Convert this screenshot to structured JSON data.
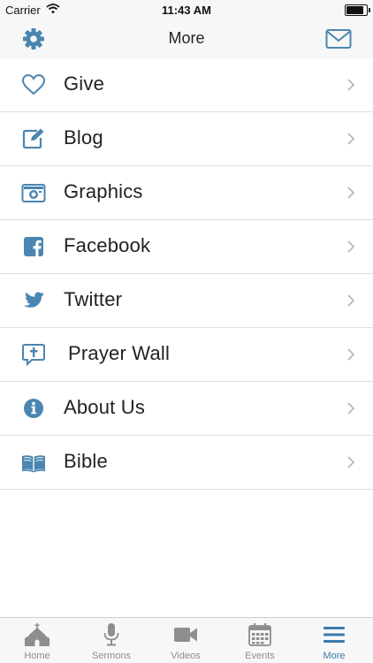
{
  "status": {
    "carrier": "Carrier",
    "time": "11:43 AM",
    "battery_level": 0.95
  },
  "header": {
    "title": "More",
    "left_icon": "gear-icon",
    "right_icon": "mail-icon"
  },
  "menu": {
    "items": [
      {
        "label": "Give",
        "icon": "heart-icon"
      },
      {
        "label": "Blog",
        "icon": "edit-icon"
      },
      {
        "label": "Graphics",
        "icon": "camera-icon"
      },
      {
        "label": "Facebook",
        "icon": "facebook-icon"
      },
      {
        "label": "Twitter",
        "icon": "twitter-icon"
      },
      {
        "label": "Prayer Wall",
        "icon": "prayer-bubble-icon"
      },
      {
        "label": "About Us",
        "icon": "info-icon"
      },
      {
        "label": "Bible",
        "icon": "book-icon"
      }
    ]
  },
  "tabs": [
    {
      "label": "Home",
      "icon": "church-icon"
    },
    {
      "label": "Sermons",
      "icon": "microphone-icon"
    },
    {
      "label": "Videos",
      "icon": "video-camera-icon"
    },
    {
      "label": "Events",
      "icon": "calendar-icon"
    },
    {
      "label": "More",
      "icon": "menu-icon",
      "active": true
    }
  ],
  "colors": {
    "accent": "#3a7bab",
    "icon_blue": "#4a86b0",
    "tab_inactive": "#8e8e8e"
  }
}
